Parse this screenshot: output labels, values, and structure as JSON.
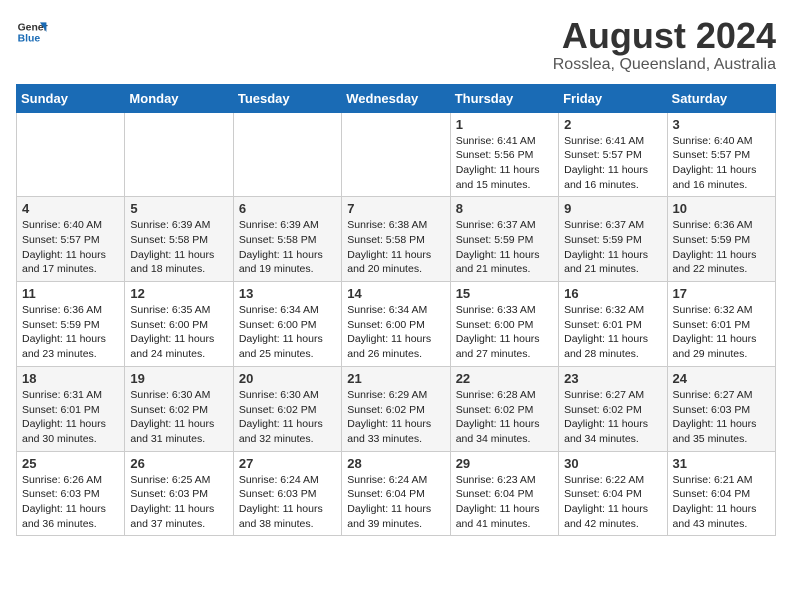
{
  "header": {
    "logo_general": "General",
    "logo_blue": "Blue",
    "title": "August 2024",
    "subtitle": "Rosslea, Queensland, Australia"
  },
  "days_of_week": [
    "Sunday",
    "Monday",
    "Tuesday",
    "Wednesday",
    "Thursday",
    "Friday",
    "Saturday"
  ],
  "weeks": [
    [
      {
        "day": "",
        "info": ""
      },
      {
        "day": "",
        "info": ""
      },
      {
        "day": "",
        "info": ""
      },
      {
        "day": "",
        "info": ""
      },
      {
        "day": "1",
        "info": "Sunrise: 6:41 AM\nSunset: 5:56 PM\nDaylight: 11 hours and 15 minutes."
      },
      {
        "day": "2",
        "info": "Sunrise: 6:41 AM\nSunset: 5:57 PM\nDaylight: 11 hours and 16 minutes."
      },
      {
        "day": "3",
        "info": "Sunrise: 6:40 AM\nSunset: 5:57 PM\nDaylight: 11 hours and 16 minutes."
      }
    ],
    [
      {
        "day": "4",
        "info": "Sunrise: 6:40 AM\nSunset: 5:57 PM\nDaylight: 11 hours and 17 minutes."
      },
      {
        "day": "5",
        "info": "Sunrise: 6:39 AM\nSunset: 5:58 PM\nDaylight: 11 hours and 18 minutes."
      },
      {
        "day": "6",
        "info": "Sunrise: 6:39 AM\nSunset: 5:58 PM\nDaylight: 11 hours and 19 minutes."
      },
      {
        "day": "7",
        "info": "Sunrise: 6:38 AM\nSunset: 5:58 PM\nDaylight: 11 hours and 20 minutes."
      },
      {
        "day": "8",
        "info": "Sunrise: 6:37 AM\nSunset: 5:59 PM\nDaylight: 11 hours and 21 minutes."
      },
      {
        "day": "9",
        "info": "Sunrise: 6:37 AM\nSunset: 5:59 PM\nDaylight: 11 hours and 21 minutes."
      },
      {
        "day": "10",
        "info": "Sunrise: 6:36 AM\nSunset: 5:59 PM\nDaylight: 11 hours and 22 minutes."
      }
    ],
    [
      {
        "day": "11",
        "info": "Sunrise: 6:36 AM\nSunset: 5:59 PM\nDaylight: 11 hours and 23 minutes."
      },
      {
        "day": "12",
        "info": "Sunrise: 6:35 AM\nSunset: 6:00 PM\nDaylight: 11 hours and 24 minutes."
      },
      {
        "day": "13",
        "info": "Sunrise: 6:34 AM\nSunset: 6:00 PM\nDaylight: 11 hours and 25 minutes."
      },
      {
        "day": "14",
        "info": "Sunrise: 6:34 AM\nSunset: 6:00 PM\nDaylight: 11 hours and 26 minutes."
      },
      {
        "day": "15",
        "info": "Sunrise: 6:33 AM\nSunset: 6:00 PM\nDaylight: 11 hours and 27 minutes."
      },
      {
        "day": "16",
        "info": "Sunrise: 6:32 AM\nSunset: 6:01 PM\nDaylight: 11 hours and 28 minutes."
      },
      {
        "day": "17",
        "info": "Sunrise: 6:32 AM\nSunset: 6:01 PM\nDaylight: 11 hours and 29 minutes."
      }
    ],
    [
      {
        "day": "18",
        "info": "Sunrise: 6:31 AM\nSunset: 6:01 PM\nDaylight: 11 hours and 30 minutes."
      },
      {
        "day": "19",
        "info": "Sunrise: 6:30 AM\nSunset: 6:02 PM\nDaylight: 11 hours and 31 minutes."
      },
      {
        "day": "20",
        "info": "Sunrise: 6:30 AM\nSunset: 6:02 PM\nDaylight: 11 hours and 32 minutes."
      },
      {
        "day": "21",
        "info": "Sunrise: 6:29 AM\nSunset: 6:02 PM\nDaylight: 11 hours and 33 minutes."
      },
      {
        "day": "22",
        "info": "Sunrise: 6:28 AM\nSunset: 6:02 PM\nDaylight: 11 hours and 34 minutes."
      },
      {
        "day": "23",
        "info": "Sunrise: 6:27 AM\nSunset: 6:02 PM\nDaylight: 11 hours and 34 minutes."
      },
      {
        "day": "24",
        "info": "Sunrise: 6:27 AM\nSunset: 6:03 PM\nDaylight: 11 hours and 35 minutes."
      }
    ],
    [
      {
        "day": "25",
        "info": "Sunrise: 6:26 AM\nSunset: 6:03 PM\nDaylight: 11 hours and 36 minutes."
      },
      {
        "day": "26",
        "info": "Sunrise: 6:25 AM\nSunset: 6:03 PM\nDaylight: 11 hours and 37 minutes."
      },
      {
        "day": "27",
        "info": "Sunrise: 6:24 AM\nSunset: 6:03 PM\nDaylight: 11 hours and 38 minutes."
      },
      {
        "day": "28",
        "info": "Sunrise: 6:24 AM\nSunset: 6:04 PM\nDaylight: 11 hours and 39 minutes."
      },
      {
        "day": "29",
        "info": "Sunrise: 6:23 AM\nSunset: 6:04 PM\nDaylight: 11 hours and 41 minutes."
      },
      {
        "day": "30",
        "info": "Sunrise: 6:22 AM\nSunset: 6:04 PM\nDaylight: 11 hours and 42 minutes."
      },
      {
        "day": "31",
        "info": "Sunrise: 6:21 AM\nSunset: 6:04 PM\nDaylight: 11 hours and 43 minutes."
      }
    ]
  ]
}
